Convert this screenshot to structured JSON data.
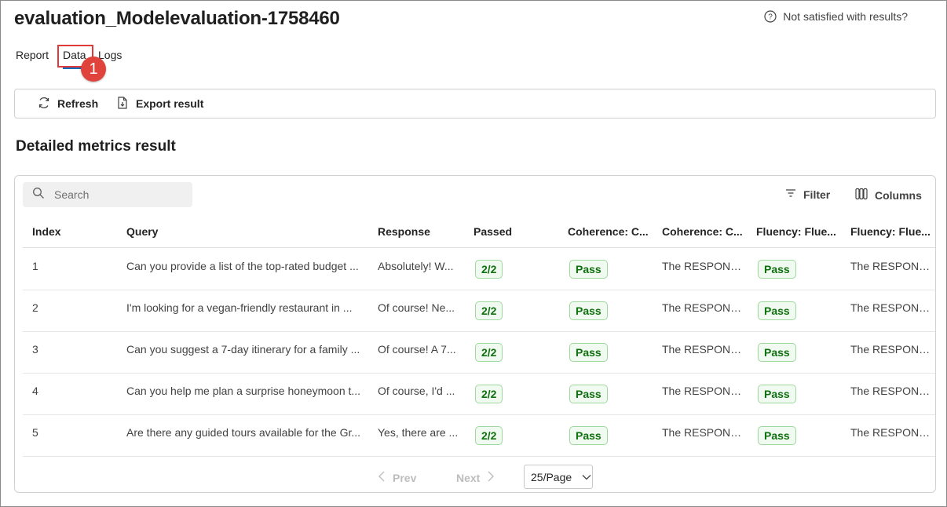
{
  "header": {
    "title": "evaluation_Modelevaluation-1758460",
    "help_text": "Not satisfied with results?"
  },
  "tabs": [
    {
      "label": "Report",
      "selected": false
    },
    {
      "label": "Data",
      "selected": true
    },
    {
      "label": "Logs",
      "selected": false
    }
  ],
  "callout": {
    "number": "1",
    "color": "#e0433b"
  },
  "toolbar": {
    "refresh_label": "Refresh",
    "export_label": "Export result"
  },
  "section_title": "Detailed metrics result",
  "search": {
    "placeholder": "Search"
  },
  "actions": {
    "filter_label": "Filter",
    "columns_label": "Columns"
  },
  "table": {
    "headers": [
      "Index",
      "Query",
      "Response",
      "Passed",
      "Coherence: C...",
      "Coherence: C...",
      "Fluency: Flue...",
      "Fluency: Flue..."
    ],
    "rows": [
      {
        "index": "1",
        "query": "Can you provide a list of the top-rated budget ...",
        "response": "Absolutely! W...",
        "passed": "2/2",
        "coherence_result": "Pass",
        "coherence_reason": "The RESPONS...",
        "fluency_result": "Pass",
        "fluency_reason": "The RESPONS..."
      },
      {
        "index": "2",
        "query": "I'm looking for a vegan-friendly restaurant in ...",
        "response": "Of course! Ne...",
        "passed": "2/2",
        "coherence_result": "Pass",
        "coherence_reason": "The RESPONS...",
        "fluency_result": "Pass",
        "fluency_reason": "The RESPONS..."
      },
      {
        "index": "3",
        "query": "Can you suggest a 7-day itinerary for a family ...",
        "response": "Of course! A 7...",
        "passed": "2/2",
        "coherence_result": "Pass",
        "coherence_reason": "The RESPONS...",
        "fluency_result": "Pass",
        "fluency_reason": "The RESPONS..."
      },
      {
        "index": "4",
        "query": "Can you help me plan a surprise honeymoon t...",
        "response": "Of course, I'd ...",
        "passed": "2/2",
        "coherence_result": "Pass",
        "coherence_reason": "The RESPONS...",
        "fluency_result": "Pass",
        "fluency_reason": "The RESPONS..."
      },
      {
        "index": "5",
        "query": "Are there any guided tours available for the Gr...",
        "response": "Yes, there are ...",
        "passed": "2/2",
        "coherence_result": "Pass",
        "coherence_reason": "The RESPONS...",
        "fluency_result": "Pass",
        "fluency_reason": "The RESPONS..."
      }
    ]
  },
  "pagination": {
    "prev_label": "Prev",
    "next_label": "Next",
    "page_size": "25/Page"
  },
  "colors": {
    "accent": "#0f6cbd",
    "pass_text": "#0e700e",
    "pass_border": "#9fd89f",
    "pass_bg": "#f1faf1",
    "highlight_box": "#e03b3b"
  },
  "icons": [
    "question-circle-icon",
    "refresh-icon",
    "export-document-icon",
    "search-icon",
    "filter-icon",
    "columns-icon",
    "chevron-left-icon",
    "chevron-right-icon",
    "chevron-down-icon"
  ]
}
